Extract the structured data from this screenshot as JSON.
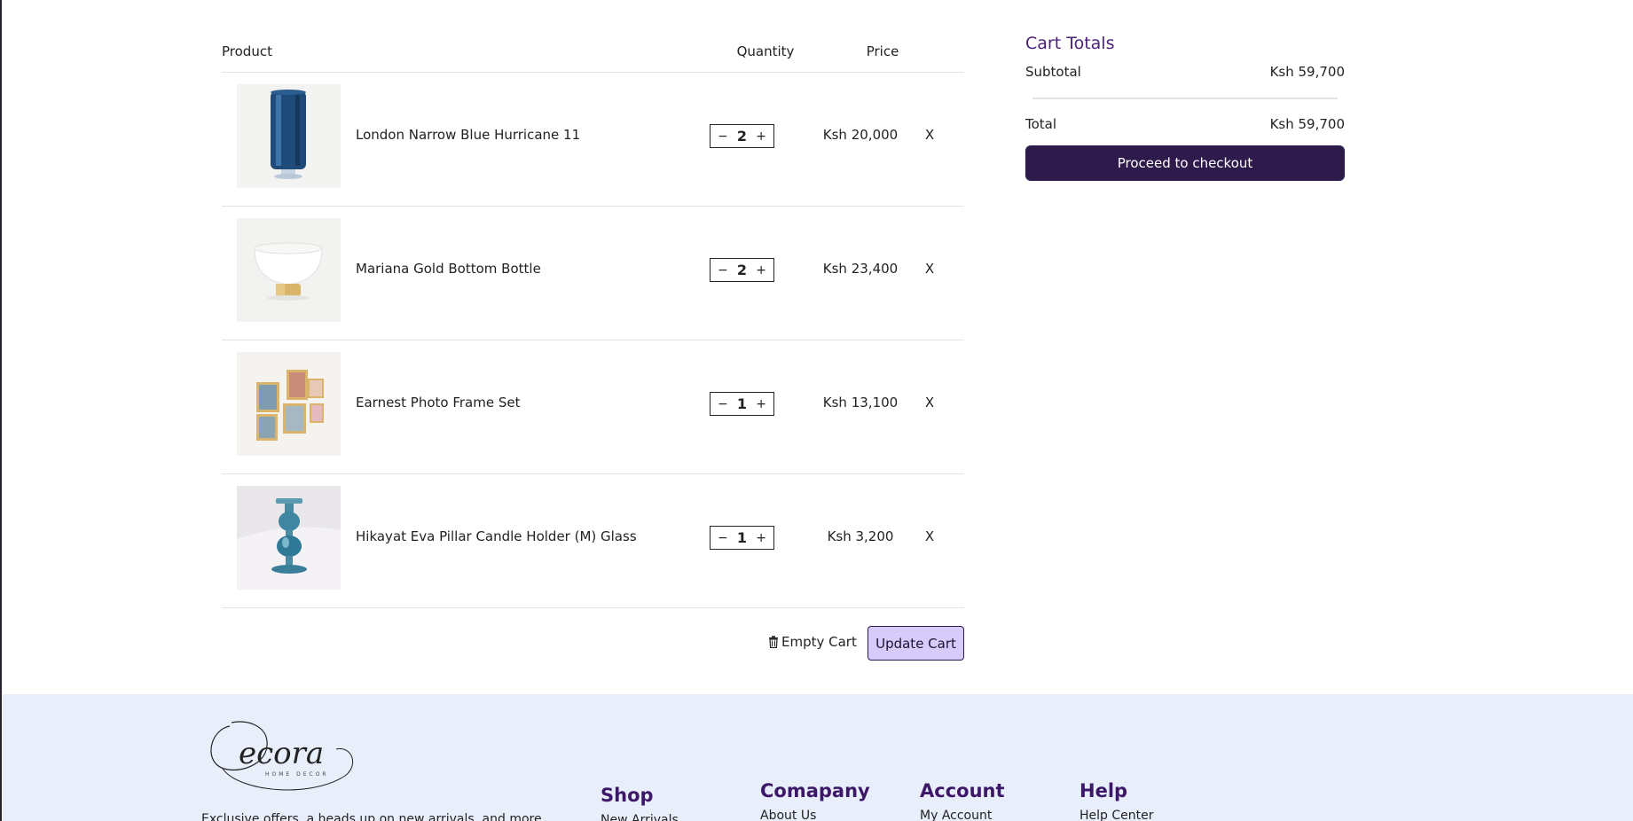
{
  "cart": {
    "headers": {
      "product": "Product",
      "quantity": "Quantity",
      "price": "Price"
    },
    "items": [
      {
        "name": "London Narrow Blue Hurricane 11",
        "qty": "2",
        "price": "Ksh 20,000",
        "remove": "X",
        "image_icon": "blue-glass-hurricane-image"
      },
      {
        "name": "Mariana Gold Bottom Bottle",
        "qty": "2",
        "price": "Ksh 23,400",
        "remove": "X",
        "image_icon": "white-bowl-gold-base-image"
      },
      {
        "name": "Earnest Photo Frame Set",
        "qty": "1",
        "price": "Ksh 13,100",
        "remove": "X",
        "image_icon": "photo-frame-set-image"
      },
      {
        "name": "Hikayat Eva Pillar Candle Holder (M) Glass",
        "qty": "1",
        "price": "Ksh 3,200",
        "remove": "X",
        "image_icon": "blue-candle-holder-image"
      }
    ],
    "qty_minus": "−",
    "qty_plus": "+",
    "empty_cart_label": "Empty Cart",
    "update_cart_label": "Update Cart"
  },
  "totals": {
    "title": "Cart Totals",
    "subtotal_label": "Subtotal",
    "subtotal_value": "Ksh 59,700",
    "total_label": "Total",
    "total_value": "Ksh 59,700",
    "checkout_label": "Proceed to checkout"
  },
  "footer": {
    "logo_text": "Decora",
    "logo_subtext": "HOME DECOR",
    "tagline": "Exclusive offers, a heads up on new arrivals, and more",
    "columns": [
      {
        "title": "Shop",
        "first_link": "New Arrivals"
      },
      {
        "title": "Comapany",
        "first_link": "About Us"
      },
      {
        "title": "Account",
        "first_link": "My Account"
      },
      {
        "title": "Help",
        "first_link": "Help Center"
      }
    ]
  },
  "colors": {
    "accent_purple": "#4b1f7a",
    "checkout_bg": "#2e1b4b",
    "update_bg": "#d6ccfb",
    "footer_bg": "#e9eefb"
  }
}
